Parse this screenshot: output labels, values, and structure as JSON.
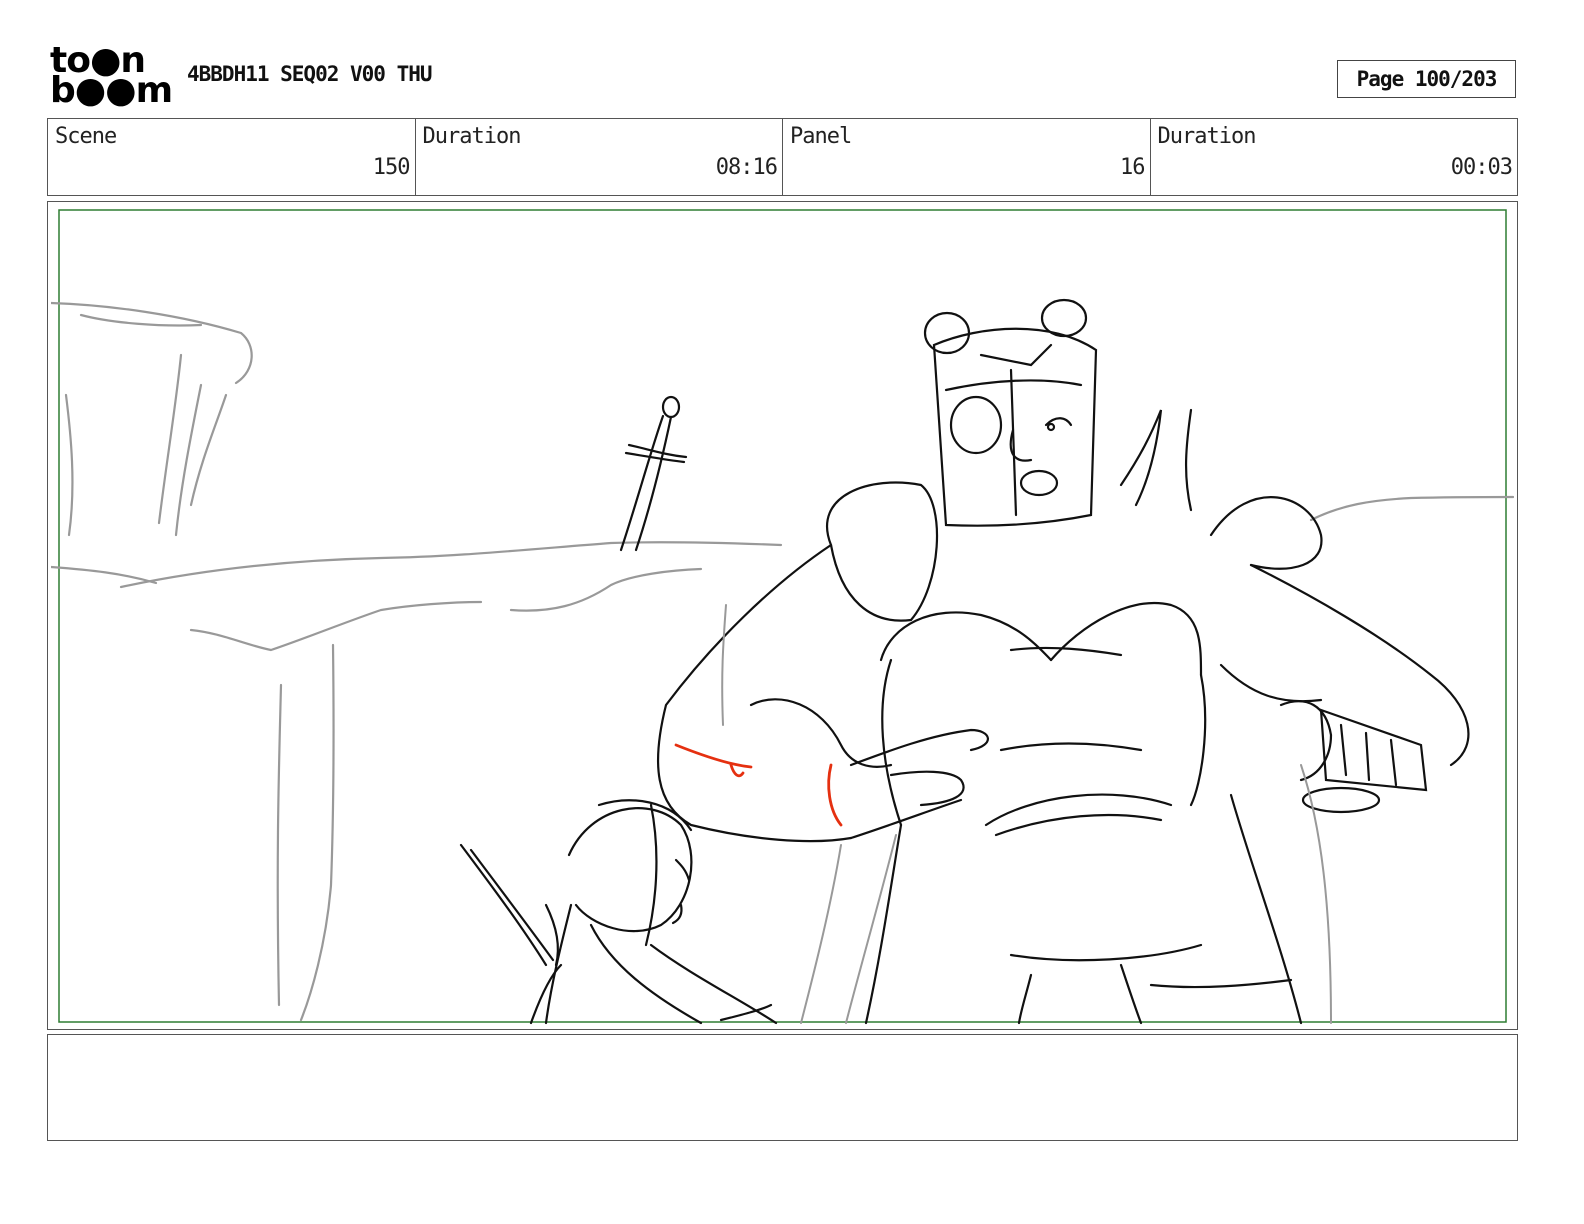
{
  "header": {
    "logo_line1": "to●n",
    "logo_line2": "b●●m",
    "title": "4BBDH11 SEQ02 V00 THU",
    "page": "Page 100/203"
  },
  "info": {
    "scene_label": "Scene",
    "scene_value": "150",
    "duration_label": "Duration",
    "duration_value": "08:16",
    "panel_label": "Panel",
    "panel_value": "16",
    "panel_duration_label": "Duration",
    "panel_duration_value": "00:03"
  },
  "colors": {
    "safe_frame": "#2e7d32",
    "background_sketch": "#999999",
    "ink": "#111111",
    "accent_red": "#e53010"
  },
  "notes": {
    "text": ""
  }
}
